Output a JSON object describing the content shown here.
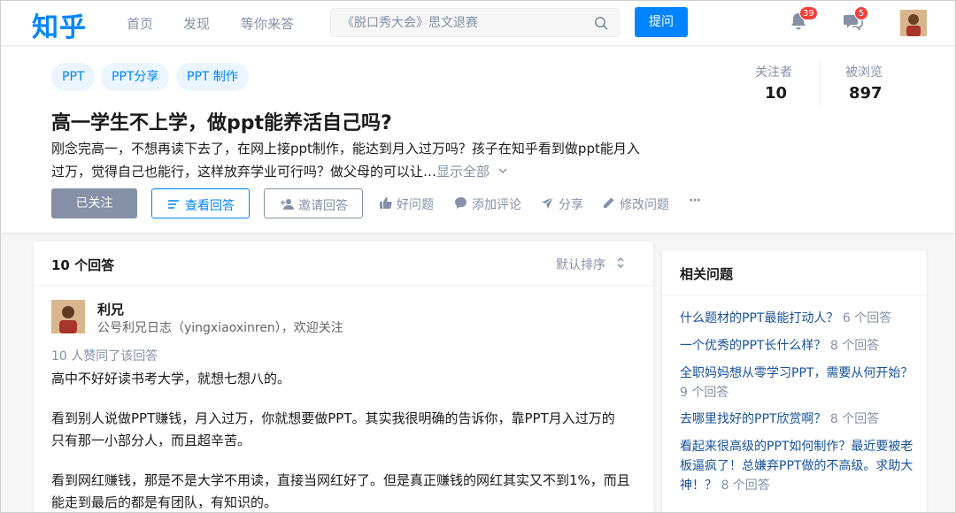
{
  "header": {
    "logo": "知乎",
    "nav": [
      "首页",
      "发现",
      "等你来答"
    ],
    "search_placeholder": "《脱口秀大会》思文退赛",
    "ask_label": "提问",
    "notifications_count": "39",
    "messages_count": "5"
  },
  "question": {
    "tags": [
      "PPT",
      "PPT分享",
      "PPT 制作"
    ],
    "title": "高一学生不上学，做ppt能养活自己吗?",
    "detail_line1": "刚念完高一，不想再读下去了，在网上接ppt制作，能达到月入过万吗？孩子在知乎看到做ppt能月入",
    "detail_line2": "过万，觉得自己也能行，这样放弃学业可行吗？做父母的可以让…",
    "show_all": "显示全部",
    "stats": {
      "followers_label": "关注者",
      "followers_value": "10",
      "views_label": "被浏览",
      "views_value": "897"
    },
    "buttons": {
      "followed": "已关注",
      "view_answers": "查看回答",
      "invite": "邀请回答"
    },
    "actions": {
      "good_question": "好问题",
      "add_comment": "添加评论",
      "share": "分享",
      "edit_question": "修改问题",
      "more": "···"
    }
  },
  "answers": {
    "count_label": "10 个回答",
    "sort_label": "默认排序",
    "first": {
      "author": "利兄",
      "bio": "公号利兄日志（yingxiaoxinren），欢迎关注",
      "votes": "10 人赞同了该回答",
      "p1": "高中不好好读书考大学，就想七想八的。",
      "p2_line1": "看到别人说做PPT赚钱，月入过万，你就想要做PPT。其实我很明确的告诉你，靠PPT月入过万的",
      "p2_line2": "只有那一小部分人，而且超辛苦。",
      "p3_line1": "看到网红赚钱，那是不是大学不用读，直接当网红好了。但是真正赚钱的网红其实又不到1%，而且",
      "p3_line2": "能走到最后的都是有团队，有知识的。"
    }
  },
  "related": {
    "title": "相关问题",
    "items": [
      {
        "q": "什么题材的PPT最能打动人？",
        "count": "6 个回答"
      },
      {
        "q": "一个优秀的PPT长什么样？",
        "count": "8 个回答"
      },
      {
        "q": "全职妈妈想从零学习PPT，需要从何开始？",
        "count": "9 个回答"
      },
      {
        "q": "去哪里找好的PPT欣赏啊？",
        "count": "8 个回答"
      },
      {
        "q": "看起来很高级的PPT如何制作？最近要被老板逼疯了！总嫌弃PPT做的不高级。求助大神！？",
        "count": "8 个回答"
      }
    ]
  },
  "colors": {
    "brand": "#0084ff",
    "muted": "#8590a6",
    "link": "#175199",
    "badge": "#f1403c"
  }
}
